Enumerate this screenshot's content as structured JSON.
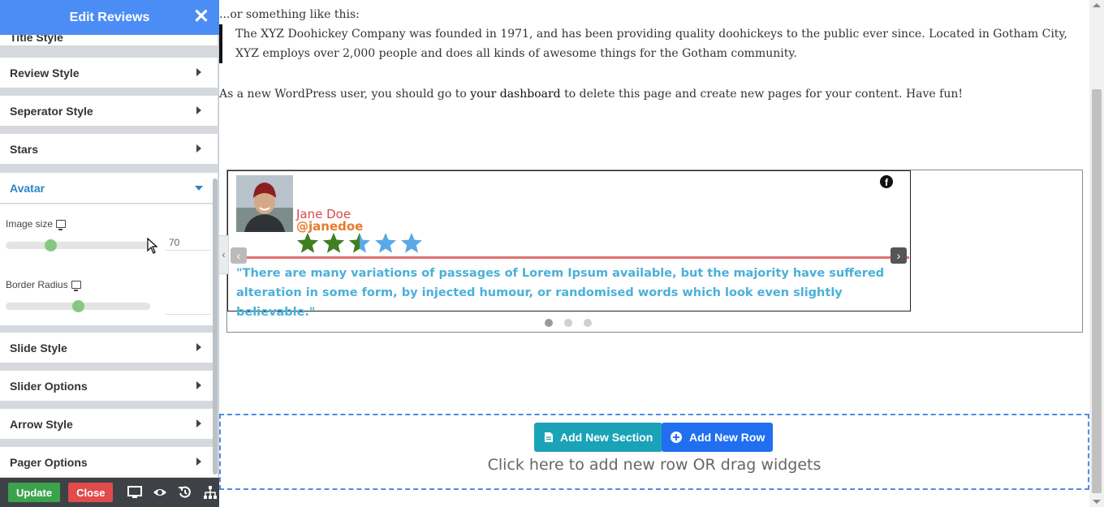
{
  "panel": {
    "title": "Edit Reviews",
    "sections": [
      {
        "label": "Title Style"
      },
      {
        "label": "Review Style"
      },
      {
        "label": "Seperator Style"
      },
      {
        "label": "Stars"
      },
      {
        "label": "Avatar"
      },
      {
        "label": "Slide Style"
      },
      {
        "label": "Slider Options"
      },
      {
        "label": "Arrow Style"
      },
      {
        "label": "Pager Options"
      }
    ],
    "avatar": {
      "image_size_label": "Image size",
      "image_size_value": "70",
      "image_size_level": 0.31,
      "border_radius_label": "Border Radius",
      "border_radius_value": "",
      "border_radius_level": 0.5
    },
    "footer": {
      "update_label": "Update",
      "close_label": "Close"
    }
  },
  "page": {
    "intro": "...or something like this:",
    "blockquote": "The XYZ Doohickey Company was founded in 1971, and has been providing quality doohickeys to the public ever since. Located in Gotham City, XYZ employs over 2,000 people and does all kinds of awesome things for the Gotham community.",
    "para_before": "As a new WordPress user, you should go to ",
    "para_link": "your dashboard",
    "para_after": " to delete this page and create new pages for your content. Have fun!",
    "review": {
      "name": "Jane Doe",
      "handle": "@janedoe",
      "rating": 2.5,
      "max_rating": 5,
      "star_filled_color": "#3f7f1e",
      "star_empty_color": "#5aa9e6",
      "text": "\"There are many variations of passages of Lorem Ipsum available, but the majority have suffered alteration in some form, by injected humour, or randomised words which look even slightly believable.\"",
      "social_icon": "facebook-icon",
      "prev_arrow": "‹",
      "next_arrow": "›",
      "pager_count": 3,
      "pager_active": 1
    },
    "add_section_label": "Add New Section",
    "add_row_label": "Add New Row",
    "drop_text": "Click here to add new row OR drag widgets"
  }
}
